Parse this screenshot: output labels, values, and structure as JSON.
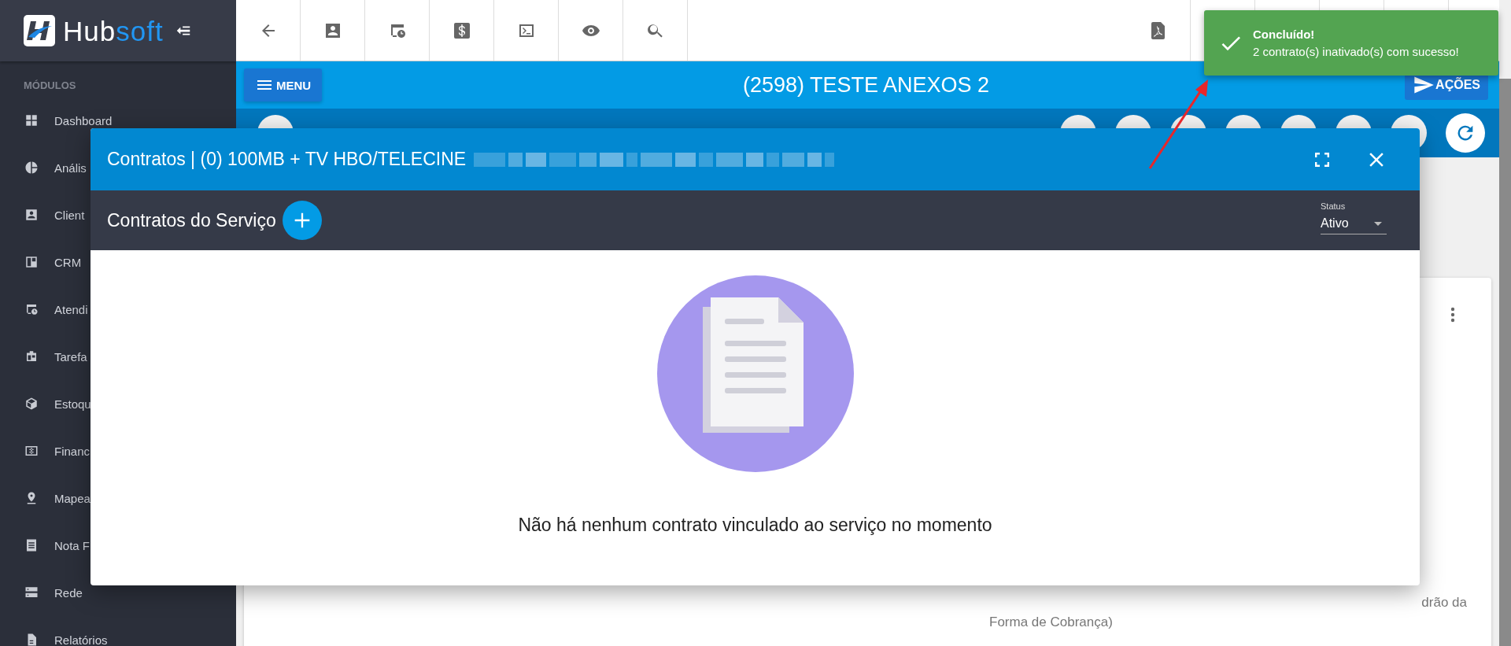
{
  "sidebar": {
    "logo": {
      "part_1": "Hub",
      "part_2": "soft"
    },
    "section_title": "MÓDULOS",
    "items": [
      {
        "label": "Dashboard"
      },
      {
        "label": "Anális"
      },
      {
        "label": "Client"
      },
      {
        "label": "CRM"
      },
      {
        "label": "Atendi"
      },
      {
        "label": "Tarefa"
      },
      {
        "label": "Estoqu"
      },
      {
        "label": "Financ"
      },
      {
        "label": "Mapea"
      },
      {
        "label": "Nota F"
      },
      {
        "label": "Rede"
      },
      {
        "label": "Relatórios"
      }
    ]
  },
  "header": {
    "menu_button": "MENU",
    "title": "(2598) TESTE ANEXOS 2",
    "actions_button": "AÇÕES"
  },
  "card": {
    "text_line_1": "drão da",
    "text_line_2": "Forma de Cobrança)"
  },
  "modal": {
    "title": "Contratos | (0) 100MB + TV HBO/TELECINE",
    "section_title": "Contratos do Serviço",
    "status_filter": {
      "label": "Status",
      "value": "Ativo"
    },
    "empty_message": "Não há nenhum contrato vinculado ao serviço no momento"
  },
  "toast": {
    "title": "Concluído!",
    "message": "2 contrato(s) inativado(s) com sucesso!"
  }
}
